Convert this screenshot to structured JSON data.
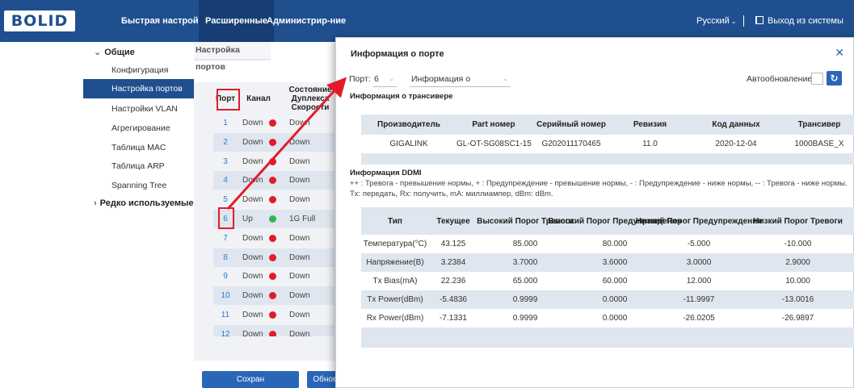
{
  "header": {
    "logo": "BOLID",
    "tabs": [
      "Быстрая настройка",
      "Расширенные",
      "Администрир-ние"
    ],
    "active_tab": "Расширенные",
    "language": "Русский",
    "logout": "Выход из системы"
  },
  "sidebar": {
    "group_general": "Общие",
    "items": [
      "Конфигурация",
      "Настройка портов",
      "Настройки VLAN",
      "Агрегирование",
      "Таблица MAC",
      "Таблица ARP",
      "Spanning Tree"
    ],
    "active_item": "Настройка портов",
    "group_rare": "Редко используемые"
  },
  "main": {
    "breadcrumb": "Настройка портов",
    "table_headers": {
      "port": "Порт",
      "channel": "Канал",
      "state": "Состояние Дуплекса Скорости"
    },
    "state_lines": [
      "Состояние",
      "Дуплекса",
      "Скорости"
    ],
    "ports": [
      {
        "num": "1",
        "channel": "Down",
        "status": "down",
        "state": "Down"
      },
      {
        "num": "2",
        "channel": "Down",
        "status": "down",
        "state": "Down"
      },
      {
        "num": "3",
        "channel": "Down",
        "status": "down",
        "state": "Down"
      },
      {
        "num": "4",
        "channel": "Down",
        "status": "down",
        "state": "Down"
      },
      {
        "num": "5",
        "channel": "Down",
        "status": "down",
        "state": "Down"
      },
      {
        "num": "6",
        "channel": "Up",
        "status": "up",
        "state": "1G Full"
      },
      {
        "num": "7",
        "channel": "Down",
        "status": "down",
        "state": "Down"
      },
      {
        "num": "8",
        "channel": "Down",
        "status": "down",
        "state": "Down"
      },
      {
        "num": "9",
        "channel": "Down",
        "status": "down",
        "state": "Down"
      },
      {
        "num": "10",
        "channel": "Down",
        "status": "down",
        "state": "Down"
      },
      {
        "num": "11",
        "channel": "Down",
        "status": "down",
        "state": "Down"
      },
      {
        "num": "12",
        "channel": "Down",
        "status": "down",
        "state": "Down"
      }
    ],
    "save_label": "Сохран",
    "refresh_label": "Обновить"
  },
  "modal": {
    "title": "Информация о порте",
    "port_label": "Порт:",
    "port_value": "6",
    "info_select": "Информация о",
    "auto_refresh_label": "Автообновление:",
    "transceiver_section": "Информация о трансивере",
    "transceiver_headers": [
      "Производитель",
      "Part номер",
      "Серийный номер",
      "Ревизия",
      "Код данных",
      "Трансивер"
    ],
    "transceiver_row": [
      "GIGALINK",
      "GL-OT-SG08SC1-15",
      "G202011170465",
      "11.0",
      "2020-12-04",
      "1000BASE_X"
    ],
    "ddmi_section": "Информация DDMI",
    "ddmi_legend_1": "++ : Тревога - превышение нормы, + : Предупреждение - превышение нормы, - : Предупреждение - ниже нормы, -- : Тревога - ниже нормы.",
    "ddmi_legend_2": "Tx: передать, Rx: получить, mA: миллиампер, dBm: dBm.",
    "ddmi_headers": [
      "Тип",
      "Текущее",
      "Высокий Порог Тревоги",
      "Высокий Порог Предупреждения",
      "Низкий Порог Предупреждения",
      "Низкий Порог Тревоги"
    ],
    "ddmi_rows": [
      [
        "Температура(°C)",
        "43.125",
        "85.000",
        "80.000",
        "-5.000",
        "-10.000"
      ],
      [
        "Напряжение(В)",
        "3.2384",
        "3.7000",
        "3.6000",
        "3.0000",
        "2.9000"
      ],
      [
        "Tx Bias(mA)",
        "22.236",
        "65.000",
        "60.000",
        "12.000",
        "10.000"
      ],
      [
        "Tx Power(dBm)",
        "-5.4836",
        "0.9999",
        "0.0000",
        "-11.9997",
        "-13.0016"
      ],
      [
        "Rx Power(dBm)",
        "-7.1331",
        "0.9999",
        "0.0000",
        "-26.0205",
        "-26.9897"
      ]
    ]
  },
  "colors": {
    "primary": "#1f4f8f",
    "accent": "#2a66b8",
    "up": "#2db84a",
    "down": "#e21b2b",
    "highlight": "#e21b2b"
  }
}
